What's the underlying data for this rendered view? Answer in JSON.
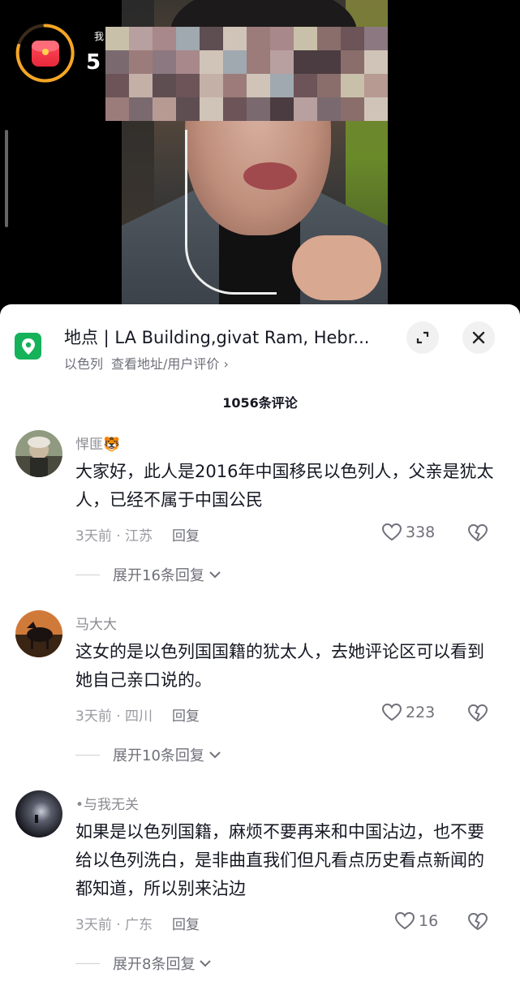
{
  "video": {
    "overlay_label": "我",
    "overlay_count": "5",
    "icons": [
      "red-packet-icon"
    ]
  },
  "location": {
    "title": "地点 | LA Building,givat Ram, Hebr...",
    "country": "以色列",
    "sub_link": "查看地址/用户评价 ›",
    "icons": [
      "location-pin-icon",
      "collapse-icon",
      "close-icon"
    ]
  },
  "comments_header": {
    "count_label": "1056条评论"
  },
  "comments": [
    {
      "username": "悍匪🐯",
      "text": "大家好，此人是2016年中国移民以色列人，父亲是犹太人，已经不属于中国公民",
      "time_location": "3天前 · 江苏",
      "reply_label": "回复",
      "likes": "338",
      "expand_label": "展开16条回复"
    },
    {
      "username": "马大大",
      "text": "这女的是以色列国国籍的犹太人，去她评论区可以看到她自己亲口说的。",
      "time_location": "3天前 · 四川",
      "reply_label": "回复",
      "likes": "223",
      "expand_label": "展开10条回复"
    },
    {
      "username": "•与我无关",
      "text": "如果是以色列国籍，麻烦不要再来和中国沾边，也不要给以色列洗白，是非曲直我们但凡看点历史看点新闻的都知道，所以别来沾边",
      "time_location": "3天前 · 广东",
      "reply_label": "回复",
      "likes": "16",
      "expand_label": "展开8条回复"
    }
  ]
}
